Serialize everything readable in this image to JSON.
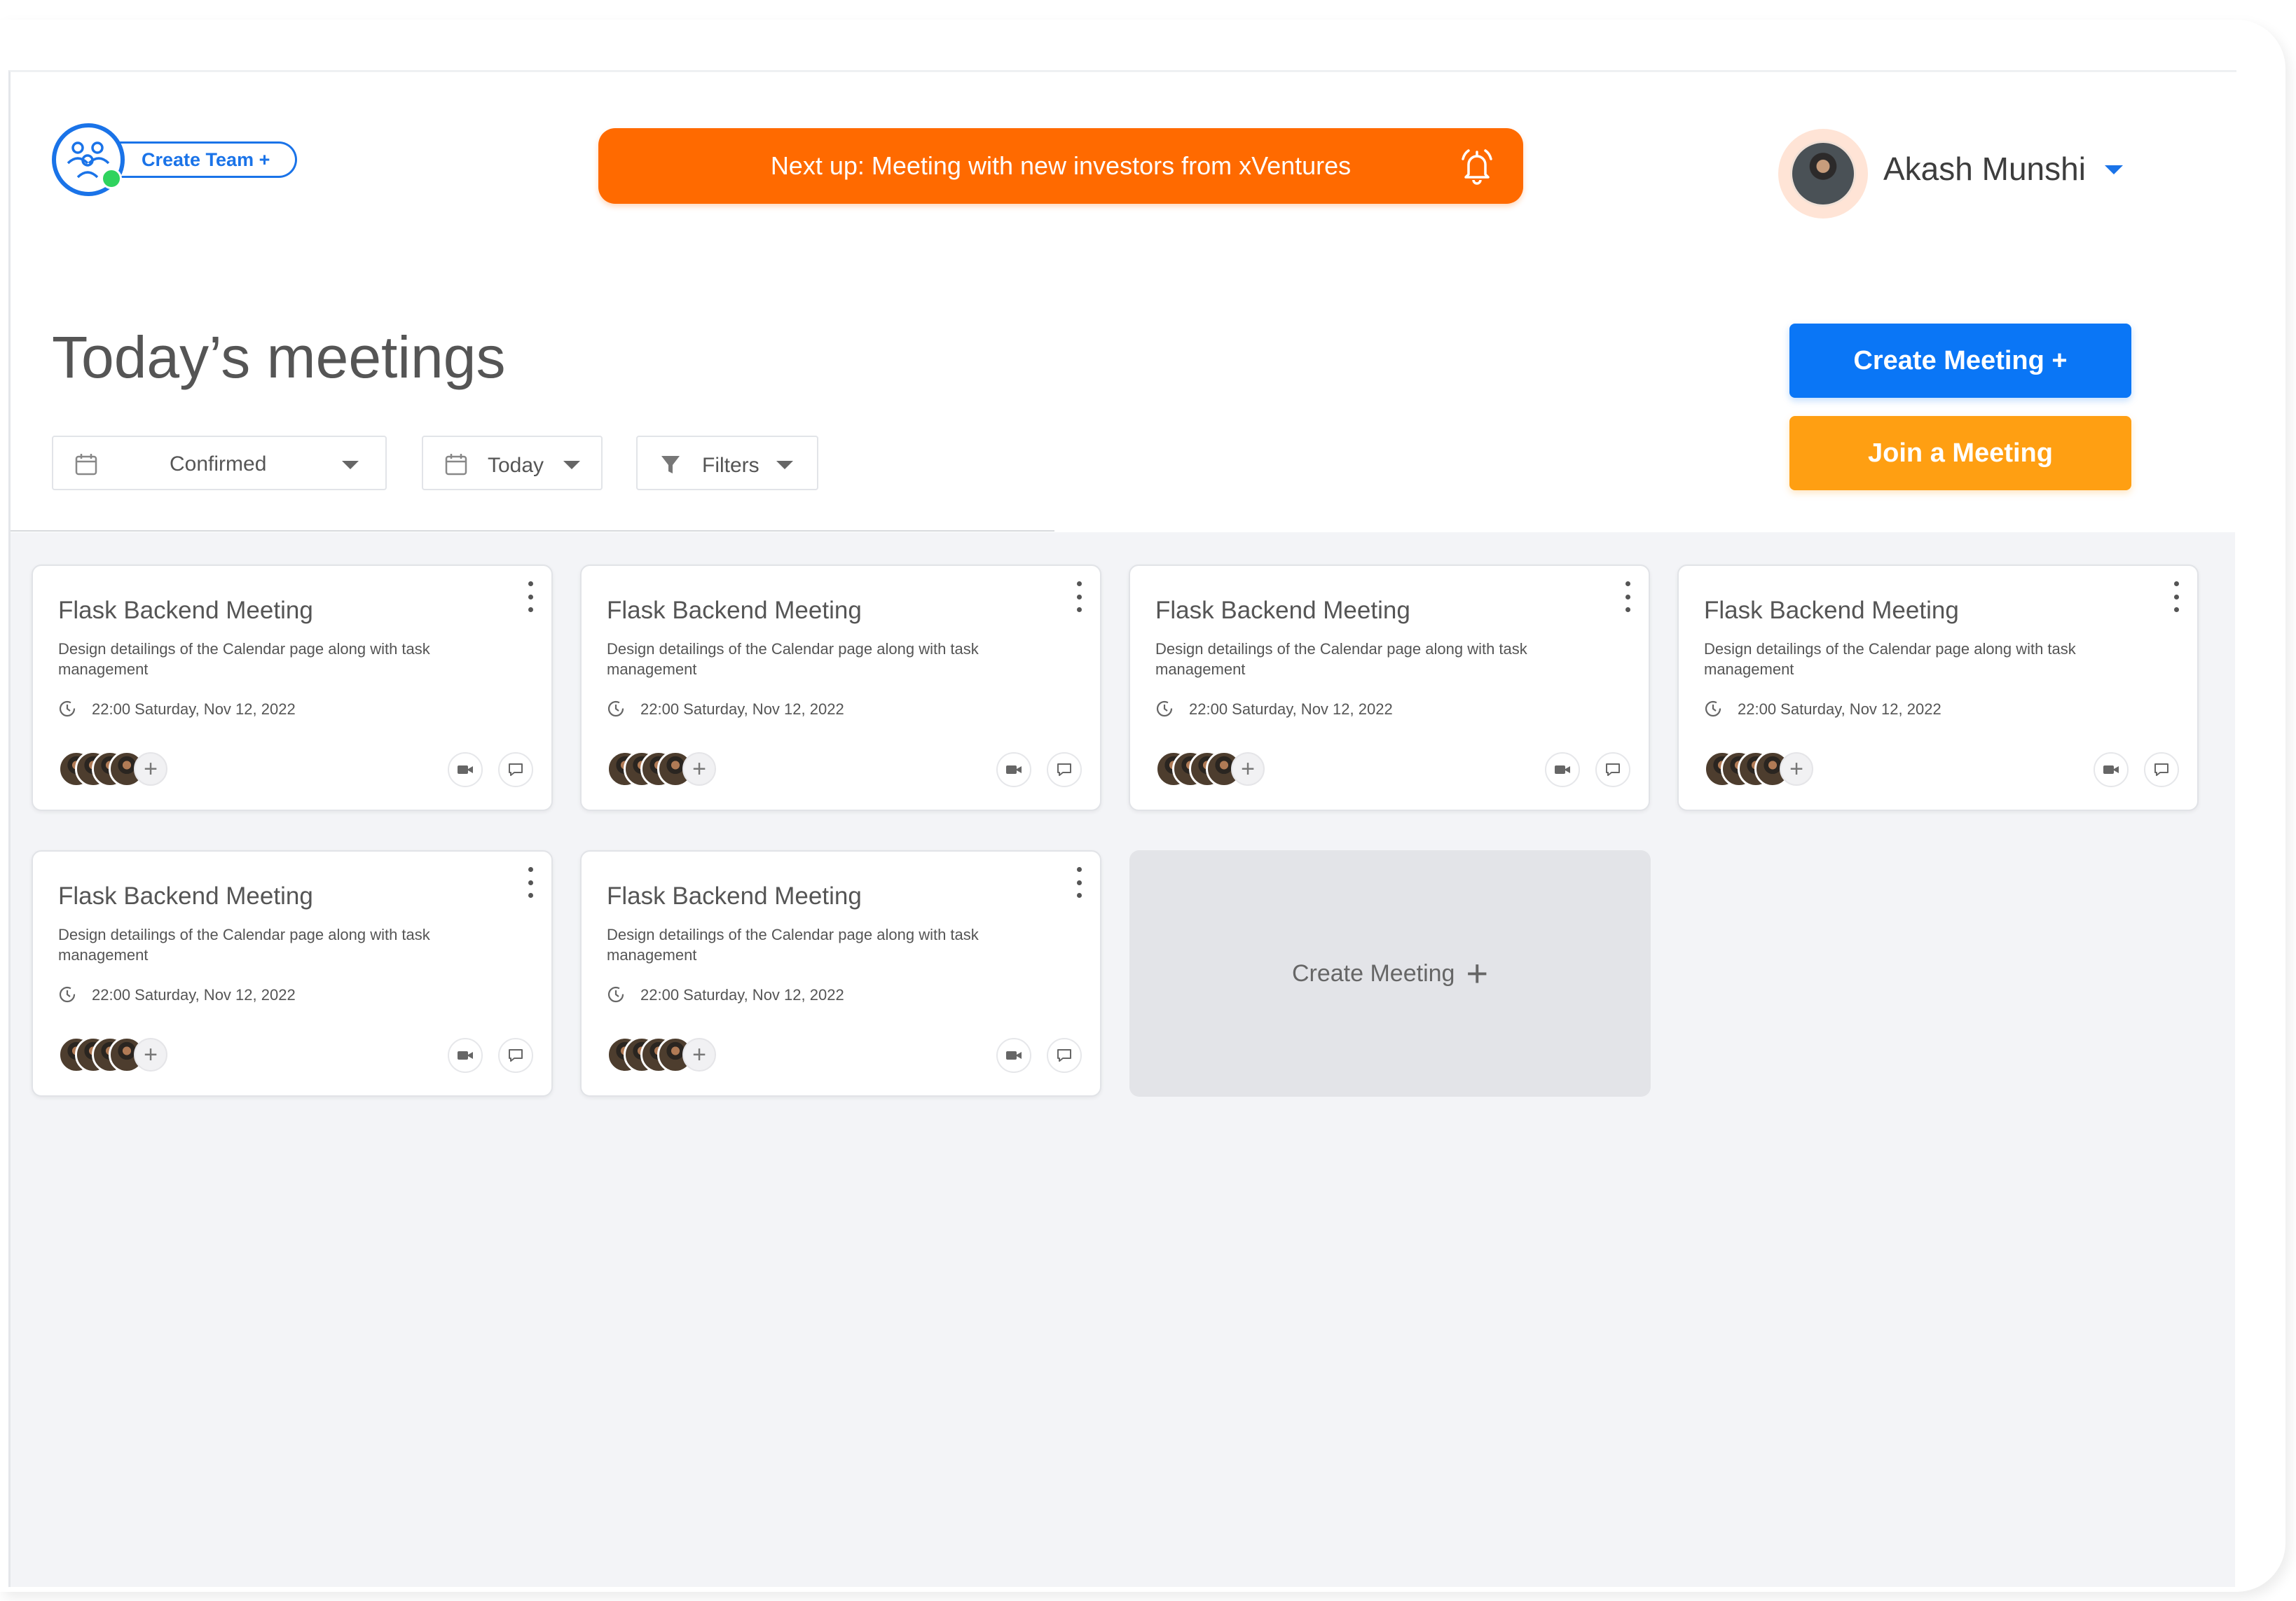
{
  "header": {
    "create_team_label": "Create Team +",
    "next_up_text": "Next up: Meeting with new investors from xVentures",
    "user_name": "Akash Munshi"
  },
  "page": {
    "title": "Today’s meetings",
    "create_meeting_label": "Create Meeting +",
    "join_meeting_label": "Join a Meeting"
  },
  "filters": {
    "status": "Confirmed",
    "date": "Today",
    "filters_label": "Filters"
  },
  "colors": {
    "primary_blue": "#0a76f6",
    "next_up_orange": "#ff6a00",
    "join_orange": "#ff9f12",
    "online_green": "#2fd35e"
  },
  "meetings": [
    {
      "title": "Flask Backend Meeting",
      "description": "Design detailings of the Calendar page along with task management",
      "time": "22:00 Saturday, Nov 12, 2022"
    },
    {
      "title": "Flask Backend Meeting",
      "description": "Design detailings of the Calendar page along with task management",
      "time": "22:00 Saturday, Nov 12, 2022"
    },
    {
      "title": "Flask Backend Meeting",
      "description": "Design detailings of the Calendar page along with task management",
      "time": "22:00 Saturday, Nov 12, 2022"
    },
    {
      "title": "Flask Backend Meeting",
      "description": "Design detailings of the Calendar page along with task management",
      "time": "22:00 Saturday, Nov 12, 2022"
    },
    {
      "title": "Flask Backend Meeting",
      "description": "Design detailings of the Calendar page along with task management",
      "time": "22:00 Saturday, Nov 12, 2022"
    },
    {
      "title": "Flask Backend Meeting",
      "description": "Design detailings of the Calendar page along with task management",
      "time": "22:00 Saturday, Nov 12, 2022"
    }
  ],
  "create_tile_label": "Create Meeting",
  "icons": {
    "team": "team-icon",
    "bell": "bell-icon",
    "calendar": "calendar-icon",
    "filter": "filter-icon",
    "clock": "clock-icon",
    "video": "video-icon",
    "chat": "chat-icon",
    "more": "more-vertical-icon",
    "add_participant": "plus-icon"
  }
}
